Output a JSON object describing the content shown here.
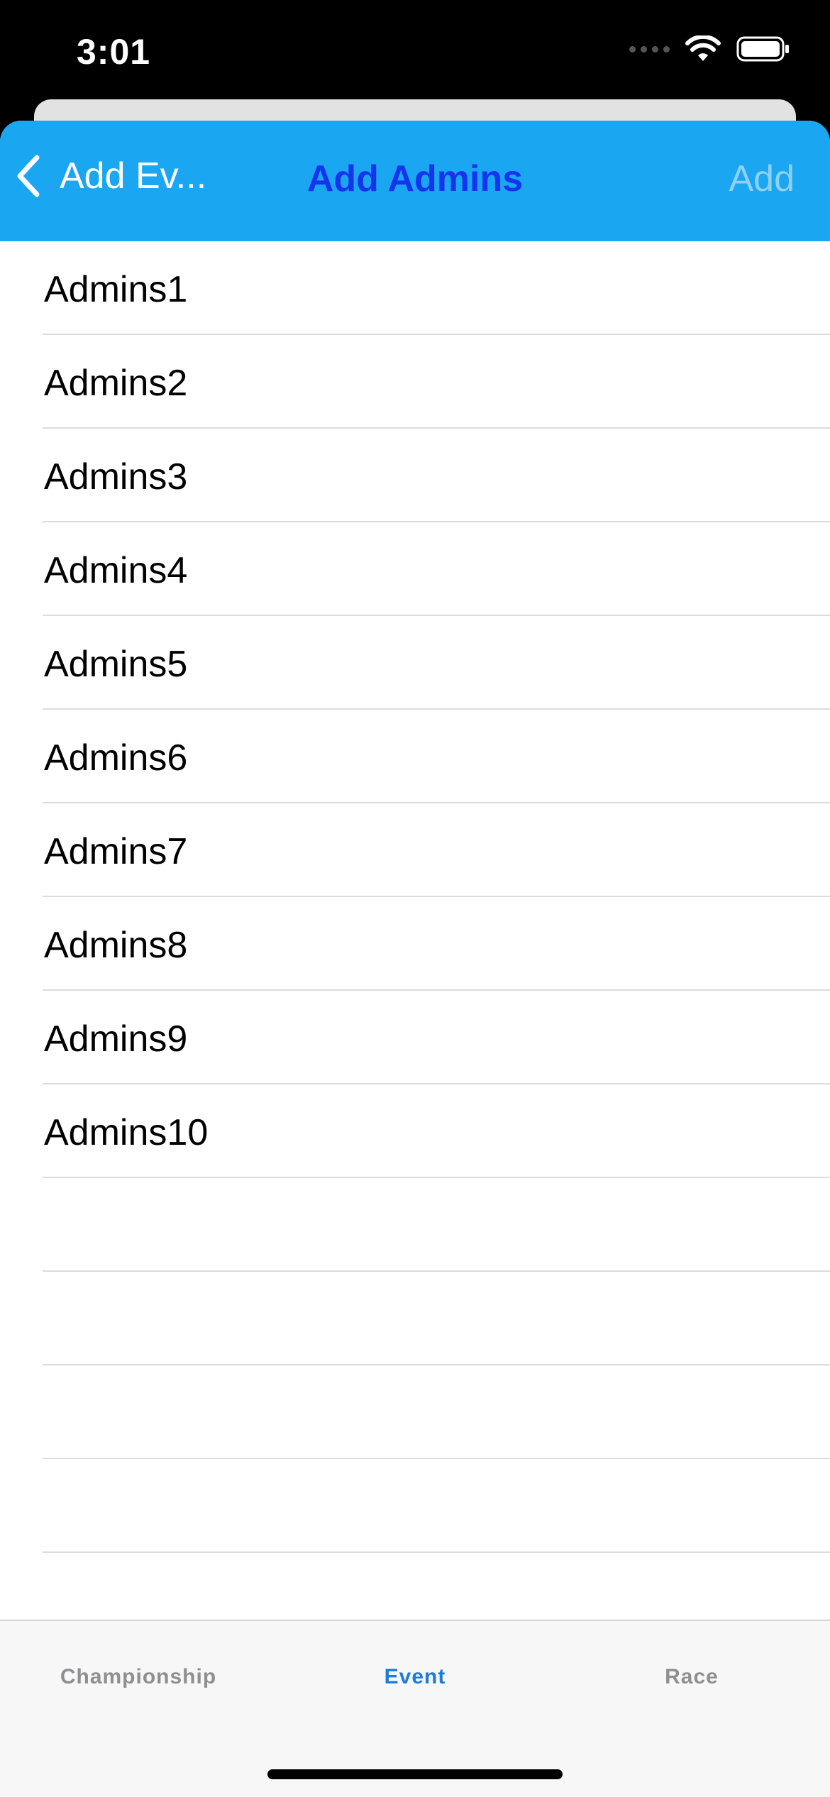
{
  "status_bar": {
    "time": "3:01",
    "icons": [
      "cellular-signal-icon",
      "wifi-icon",
      "battery-icon"
    ]
  },
  "nav": {
    "back_label": "Add Ev...",
    "back_icon": "chevron-left-icon",
    "title": "Add Admins",
    "add_label": "Add"
  },
  "list": {
    "items": [
      {
        "label": "Admins1"
      },
      {
        "label": "Admins2"
      },
      {
        "label": "Admins3"
      },
      {
        "label": "Admins4"
      },
      {
        "label": "Admins5"
      },
      {
        "label": "Admins6"
      },
      {
        "label": "Admins7"
      },
      {
        "label": "Admins8"
      },
      {
        "label": "Admins9"
      },
      {
        "label": "Admins10"
      },
      {
        "label": ""
      },
      {
        "label": ""
      },
      {
        "label": ""
      },
      {
        "label": ""
      },
      {
        "label": ""
      }
    ]
  },
  "tabs": [
    {
      "label": "Championship",
      "selected": false
    },
    {
      "label": "Event",
      "selected": true
    },
    {
      "label": "Race",
      "selected": false
    }
  ],
  "colors": {
    "nav_background": "#1ba6f2",
    "title_color": "#1534ee",
    "add_disabled_color": "#8fd0f6",
    "tab_selected_color": "#1a7bd8",
    "tab_unselected_color": "#8e8e93"
  }
}
